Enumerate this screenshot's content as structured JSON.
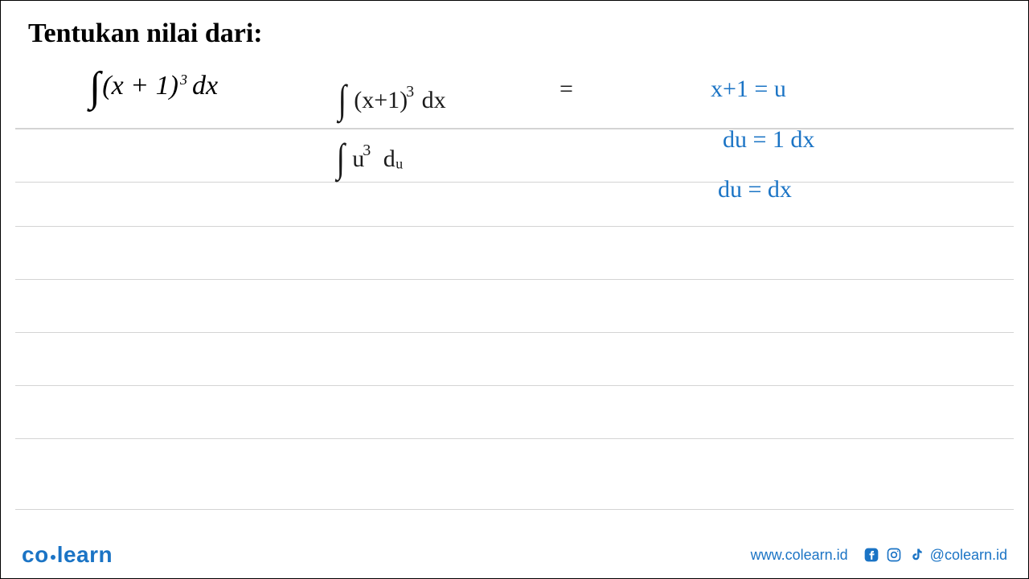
{
  "title": "Tentukan nilai dari:",
  "printed": {
    "lparen": "(",
    "expr": "x + 1",
    "rparen": ")",
    "exp": "3",
    "dx": "dx"
  },
  "handwritten": {
    "line1_left": "(x+1)",
    "line1_exp": "3",
    "line1_dx": "dx",
    "line1_eq": "=",
    "line2_left": "u",
    "line2_exp": "3",
    "line2_dx": "dᵤ"
  },
  "substitution": {
    "s1": "x+1 = u",
    "s2": "du = 1 dx",
    "s3": "du = dx"
  },
  "footer": {
    "brand_a": "co",
    "brand_b": "learn",
    "website": "www.colearn.id",
    "handle": "@colearn.id"
  }
}
